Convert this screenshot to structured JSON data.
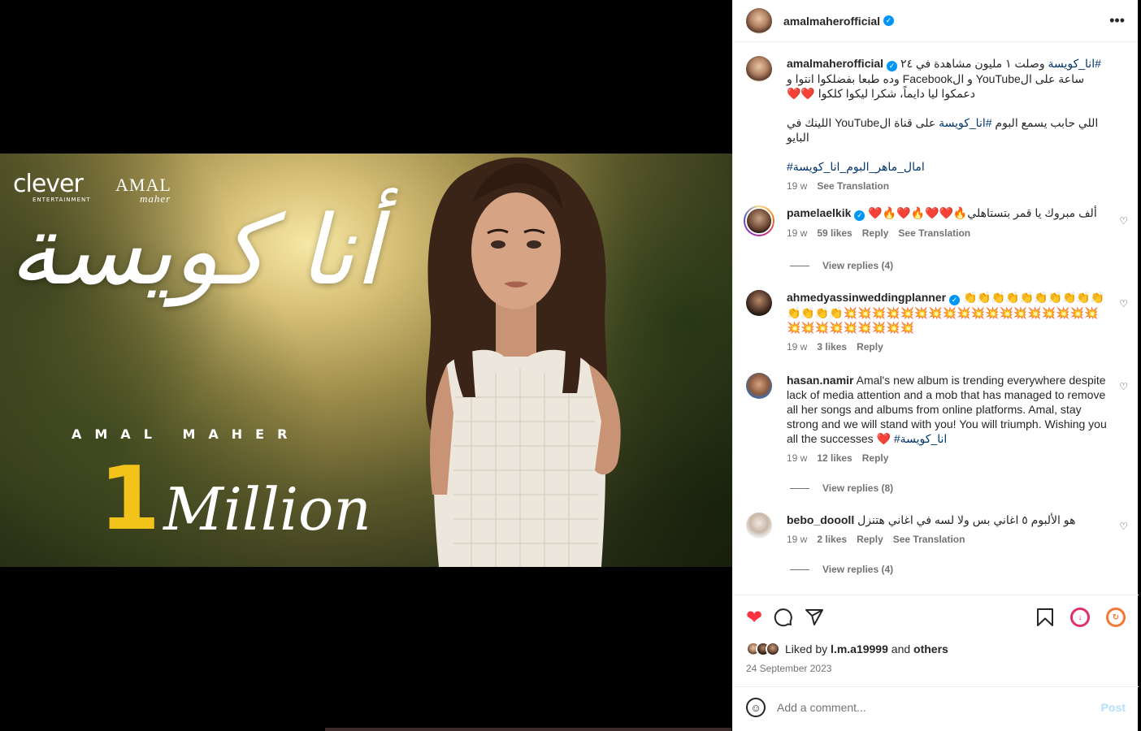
{
  "post_image": {
    "brand_left": "clever",
    "brand_left_sub": "ENTERTAINMENT",
    "brand_right": "AMAL",
    "brand_right_sub": "maher",
    "title_arabic": "أنا كويسة",
    "artist": "AMAL MAHER",
    "milestone_number": "1",
    "milestone_word": "Million"
  },
  "header": {
    "username": "amalmaherofficial",
    "verified": true,
    "more_icon": "ellipsis-horizontal-icon"
  },
  "caption": {
    "username": "amalmaherofficial",
    "tag_1": "#انا_كويسة",
    "line_1": "وصلت ١ مليون مشاهدة في ٢٤ ساعة على الYouTube و الFacebook وده طبعا بفضلكوا انتوا و دعمكوا ليا دايماً، شكرا ليكوا كلكوا ❤️❤️",
    "line_2_prefix": "اللي حابب يسمع البوم",
    "tag_2": "#انا_كويسة",
    "line_2_suffix": "على قناة الYouTube اللينك في البايو",
    "tag_3": "#امال_ماهر_البوم_انا_كويسة",
    "time": "19 w",
    "see_translation": "See Translation"
  },
  "comments": [
    {
      "username": "pamelaelkik",
      "verified": true,
      "text": "ألف مبروك يا قمر بتستاهلي🔥❤️❤️🔥❤️🔥❤️",
      "time": "19 w",
      "likes": "59 likes",
      "reply": "Reply",
      "see_translation": "See Translation",
      "view_replies": "View replies (4)"
    },
    {
      "username": "ahmedyassinweddingplanner",
      "verified": true,
      "text": "👏👏👏👏👏👏👏👏👏👏👏👏👏👏💥💥💥💥💥💥💥💥💥💥💥💥💥💥💥💥💥💥💥💥💥💥💥💥💥💥💥",
      "time": "19 w",
      "likes": "3 likes",
      "reply": "Reply"
    },
    {
      "username": "hasan.namir",
      "verified": false,
      "text": "Amal's new album is trending everywhere despite lack of media attention and a mob that has managed to remove all her songs and albums from online platforms. Amal, stay strong and we will stand with you! You will triumph. Wishing you all the successes ❤️",
      "tag": "#انا_كويسة",
      "time": "19 w",
      "likes": "12 likes",
      "reply": "Reply",
      "view_replies": "View replies (8)"
    },
    {
      "username": "bebo_doooll",
      "verified": false,
      "text": "هو الألبوم ٥ اغاني بس ولا لسه في اغاني هتنزل",
      "time": "19 w",
      "likes": "2 likes",
      "reply": "Reply",
      "see_translation": "See Translation",
      "view_replies": "View replies (4)"
    }
  ],
  "actions": {
    "like_icon": "heart-filled-icon",
    "comment_icon": "comment-bubble-icon",
    "share_icon": "paper-plane-icon",
    "save_icon": "bookmark-icon",
    "like_color": "#ff3040"
  },
  "likes_summary": {
    "prefix": "Liked by",
    "user": "l.m.a19999",
    "joiner": "and",
    "others": "others"
  },
  "date": "24 September 2023",
  "add_comment": {
    "placeholder": "Add a comment...",
    "post_label": "Post"
  }
}
